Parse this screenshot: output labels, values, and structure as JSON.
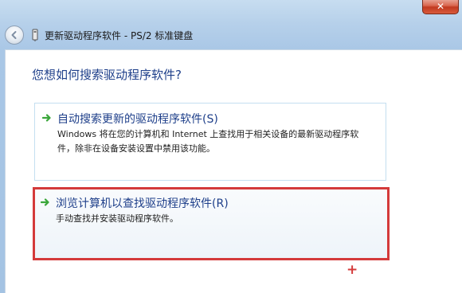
{
  "window": {
    "close_label": "✕",
    "title": "更新驱动程序软件 - PS/2 标准键盘"
  },
  "main": {
    "question": "您想如何搜索驱动程序软件?",
    "options": [
      {
        "title": "自动搜索更新的驱动程序软件(S)",
        "description": "Windows 将在您的计算机和 Internet 上查找用于相关设备的最新驱动程序软件，除非在设备安装设置中禁用该功能。"
      },
      {
        "title": "浏览计算机以查找驱动程序软件(R)",
        "description": "手动查找并安装驱动程序软件。"
      }
    ],
    "annotation_mark": "+"
  },
  "colors": {
    "accent_text": "#1e3f8a",
    "highlight_border": "#d43a3a",
    "arrow_green": "#3aa63a"
  },
  "icons": {
    "back": "back-arrow-icon",
    "device": "device-icon",
    "option_arrow": "green-arrow-icon"
  }
}
